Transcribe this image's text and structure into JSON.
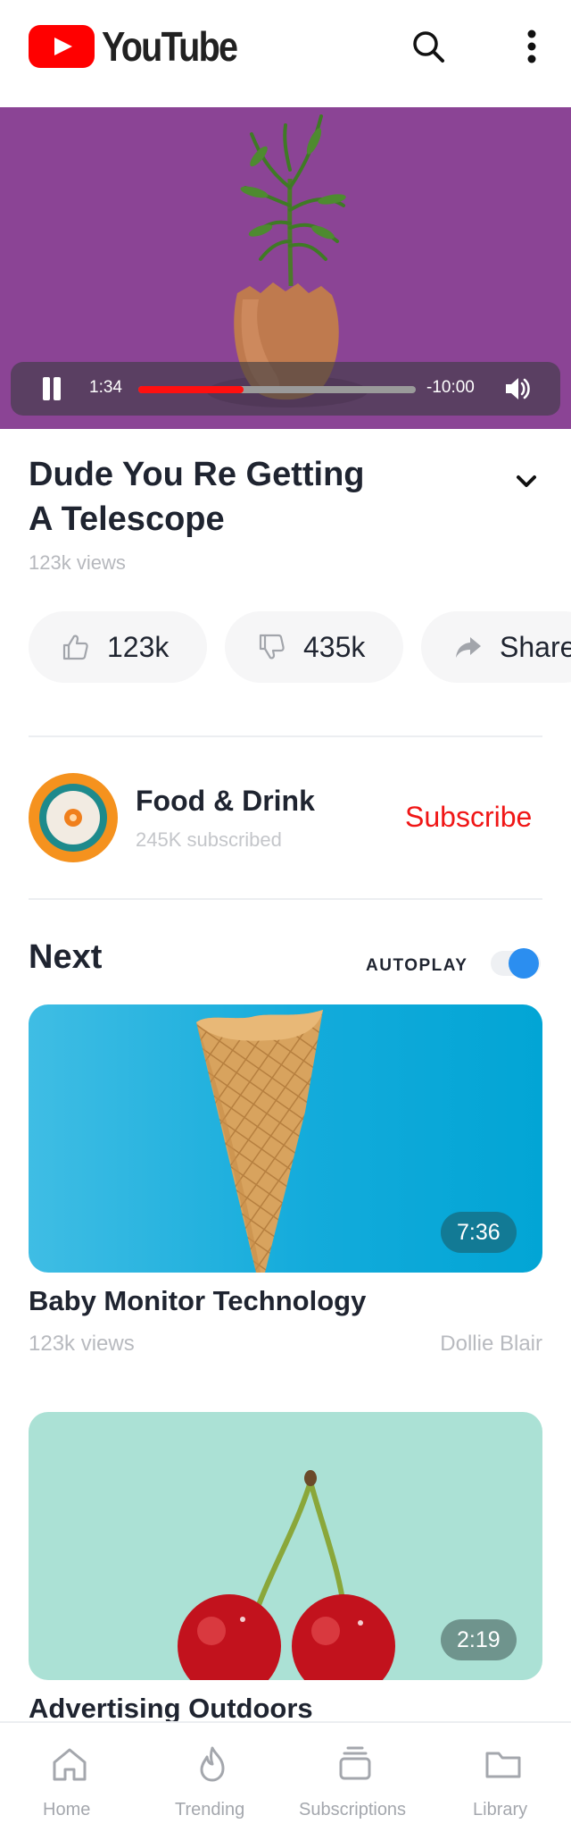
{
  "app": {
    "logo_text": "YouTube",
    "brand_color": "#ff0000"
  },
  "header": {
    "icons": [
      "youtube-logo-icon",
      "search-icon",
      "more-vertical-icon"
    ]
  },
  "player": {
    "elapsed": "1:34",
    "remaining": "-10:00",
    "progress": 0.38,
    "state": "playing",
    "background_color": "#8b4495",
    "icons": [
      "pause-icon",
      "volume-icon"
    ]
  },
  "video": {
    "title_line1": "Dude You Re Getting",
    "title_line2": "A Telescope",
    "views": "123k views"
  },
  "actions": {
    "like_count": "123k",
    "dislike_count": "435k",
    "share_label": "Share"
  },
  "channel": {
    "name": "Food & Drink",
    "subscribers": "245K subscribed",
    "subscribe_label": "Subscribe",
    "subscribe_color": "#f01616"
  },
  "next": {
    "heading": "Next",
    "autoplay_label": "AUTOPLAY",
    "autoplay_on": true,
    "toggle_color": "#2b8ef0",
    "videos": [
      {
        "title": "Baby Monitor Technology",
        "views": "123k views",
        "author": "Dollie Blair",
        "duration": "7:36"
      },
      {
        "title": "Advertising Outdoors",
        "duration": "2:19"
      }
    ]
  },
  "bottom_nav": {
    "items": [
      {
        "label": "Home",
        "icon": "home-icon"
      },
      {
        "label": "Trending",
        "icon": "flame-icon"
      },
      {
        "label": "Subscriptions",
        "icon": "subscriptions-icon"
      },
      {
        "label": "Library",
        "icon": "folder-icon"
      }
    ]
  }
}
